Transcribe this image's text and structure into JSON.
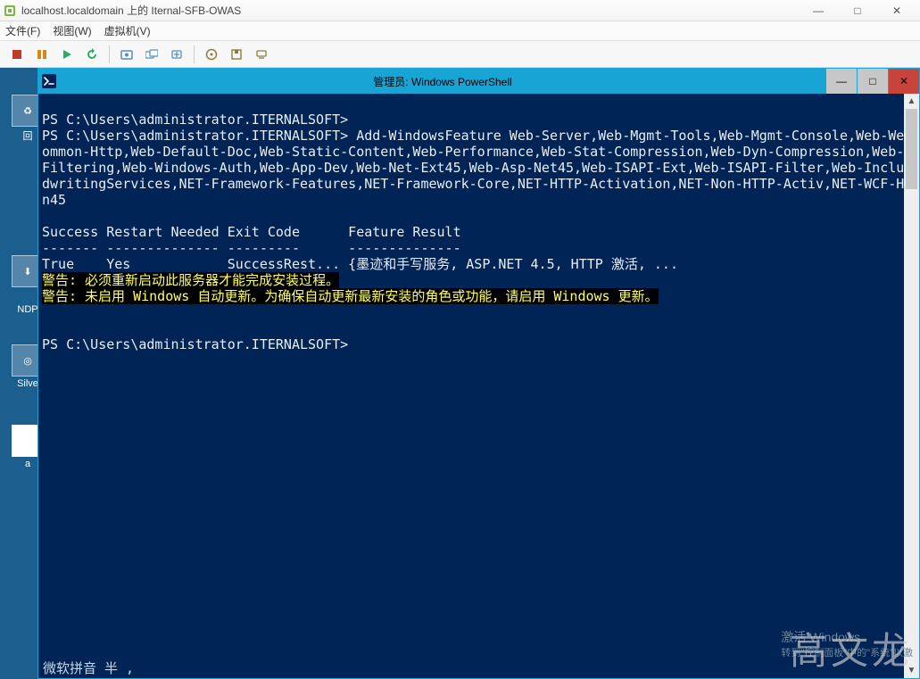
{
  "vm": {
    "title": "localhost.localdomain 上的 Iternal-SFB-OWAS",
    "menu": {
      "file": "文件(F)",
      "view": "视图(W)",
      "vm": "虚拟机(V)"
    },
    "win": {
      "min": "—",
      "max": "□",
      "close": "✕"
    }
  },
  "desk": {
    "icon1": "回",
    "icon2": "",
    "icon3": "NDP",
    "icon4": "Silve",
    "icon5": "a"
  },
  "ps": {
    "title": "管理员: Windows PowerShell",
    "ctrls": {
      "min": "—",
      "max": "□",
      "close": "✕"
    },
    "lines": {
      "l1": "PS C:\\Users\\administrator.ITERNALSOFT>",
      "l2": "PS C:\\Users\\administrator.ITERNALSOFT> Add-WindowsFeature Web-Server,Web-Mgmt-Tools,Web-Mgmt-Console,Web-WebServer",
      "l3": "ommon-Http,Web-Default-Doc,Web-Static-Content,Web-Performance,Web-Stat-Compression,Web-Dyn-Compression,Web-Securit",
      "l4": "Filtering,Web-Windows-Auth,Web-App-Dev,Web-Net-Ext45,Web-Asp-Net45,Web-ISAPI-Ext,Web-ISAPI-Filter,Web-Includes,Ink",
      "l5": "dwritingServices,NET-Framework-Features,NET-Framework-Core,NET-HTTP-Activation,NET-Non-HTTP-Activ,NET-WCF-HTTP-Act",
      "l6": "n45",
      "hdr": "Success Restart Needed Exit Code      Feature Result",
      "sep": "------- -------------- ---------      --------------",
      "row": "True    Yes            SuccessRest... {墨迹和手写服务, ASP.NET 4.5, HTTP 激活, ...",
      "warn1": "警告: 必须重新启动此服务器才能完成安装过程。",
      "warn2": "警告: 未启用 Windows 自动更新。为确保自动更新最新安装的角色或功能，请启用 Windows 更新。",
      "prompt2": "PS C:\\Users\\administrator.ITERNALSOFT>"
    }
  },
  "activate": {
    "l1": "激活 Windows",
    "l2": "转到\"控制面板\"中的\"系统\"以激"
  },
  "ime": "微软拼音 半 ,",
  "watermark": "高文龙"
}
